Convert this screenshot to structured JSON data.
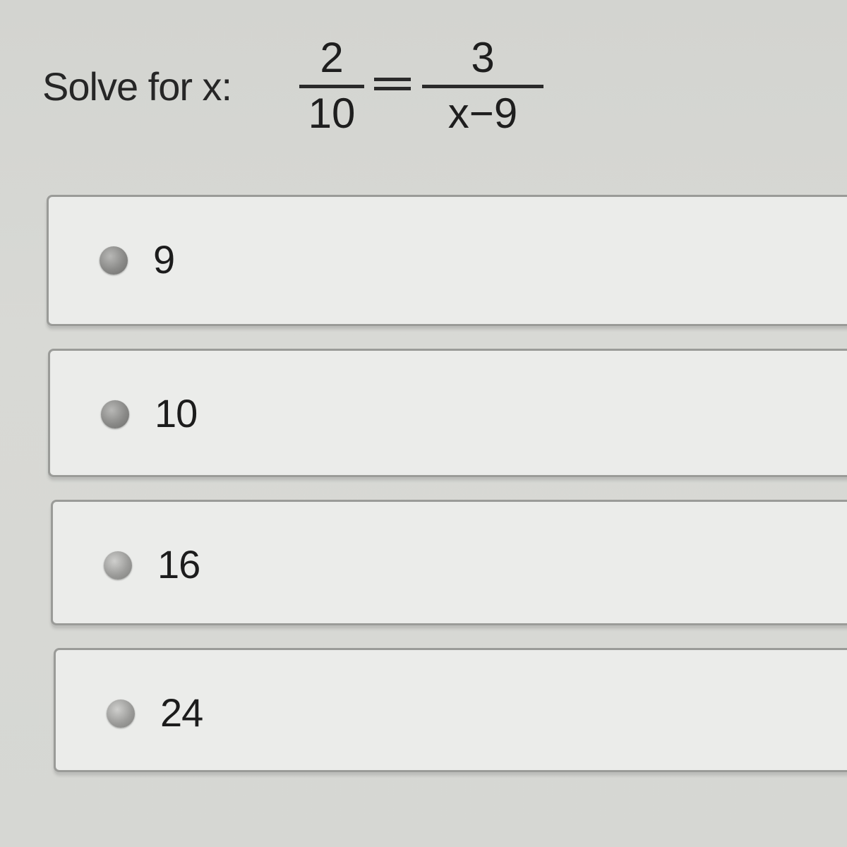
{
  "question": {
    "prompt": "Solve for x:",
    "left_fraction": {
      "numerator": "2",
      "denominator": "10"
    },
    "right_fraction": {
      "numerator": "3",
      "denominator": "x−9"
    }
  },
  "options": [
    {
      "label": "9"
    },
    {
      "label": "10"
    },
    {
      "label": "16"
    },
    {
      "label": "24"
    }
  ]
}
